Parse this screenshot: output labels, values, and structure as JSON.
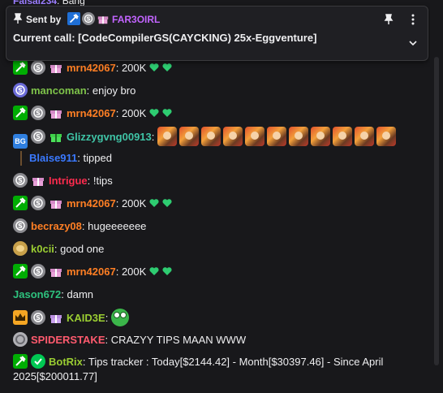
{
  "partial_top": {
    "name": "Faisal234",
    "text": ": Bang"
  },
  "pinned": {
    "sent_by_label": "Sent by",
    "sender": "FAR3OIRL",
    "sender_color": "#c264ff",
    "message": "Current call: [CodeCompilerGS(CAYCKING) 25x-Eggventure]"
  },
  "messages": [
    {
      "user": "mrn42067",
      "color": "#ff7f24",
      "text": ": 200K"
    },
    {
      "user": "mancoman",
      "color": "#7ec34a",
      "text": ": enjoy bro"
    },
    {
      "user": "mrn42067",
      "color": "#ff7f24",
      "text": ": 200K"
    },
    {
      "user": "Glizzygvng00913",
      "color": "#3fc4a6",
      "text": ":"
    },
    {
      "user": "Blaise911",
      "color": "#3a79ff",
      "text": ": tipped"
    },
    {
      "user": "Intrigue",
      "color": "#ff2b4e",
      "text": ": !tips"
    },
    {
      "user": "mrn42067",
      "color": "#ff7f24",
      "text": ": 200K"
    },
    {
      "user": "becrazy08",
      "color": "#ff7f24",
      "text": ": hugeeeeeee"
    },
    {
      "user": "k0cii",
      "color": "#9acd32",
      "text": ": good one"
    },
    {
      "user": "mrn42067",
      "color": "#ff7f24",
      "text": ": 200K"
    },
    {
      "user": "Jason672",
      "color": "#2ec27e",
      "text": ": damn"
    },
    {
      "user": "KAID3E",
      "color": "#9acd32",
      "text": ":"
    },
    {
      "user": "SPIDERSTAKE",
      "color": "#ff5a6e",
      "text": ": CRAZYY TIPS MAAN WWW"
    },
    {
      "user": "BotRix",
      "color": "#9acd32",
      "text": ": Tips tracker : Today[$2144.42] - Month[$30397.46] - Since April"
    },
    {
      "user": "",
      "color": "#efeff1",
      "text": "2025[$200011.77]"
    }
  ]
}
